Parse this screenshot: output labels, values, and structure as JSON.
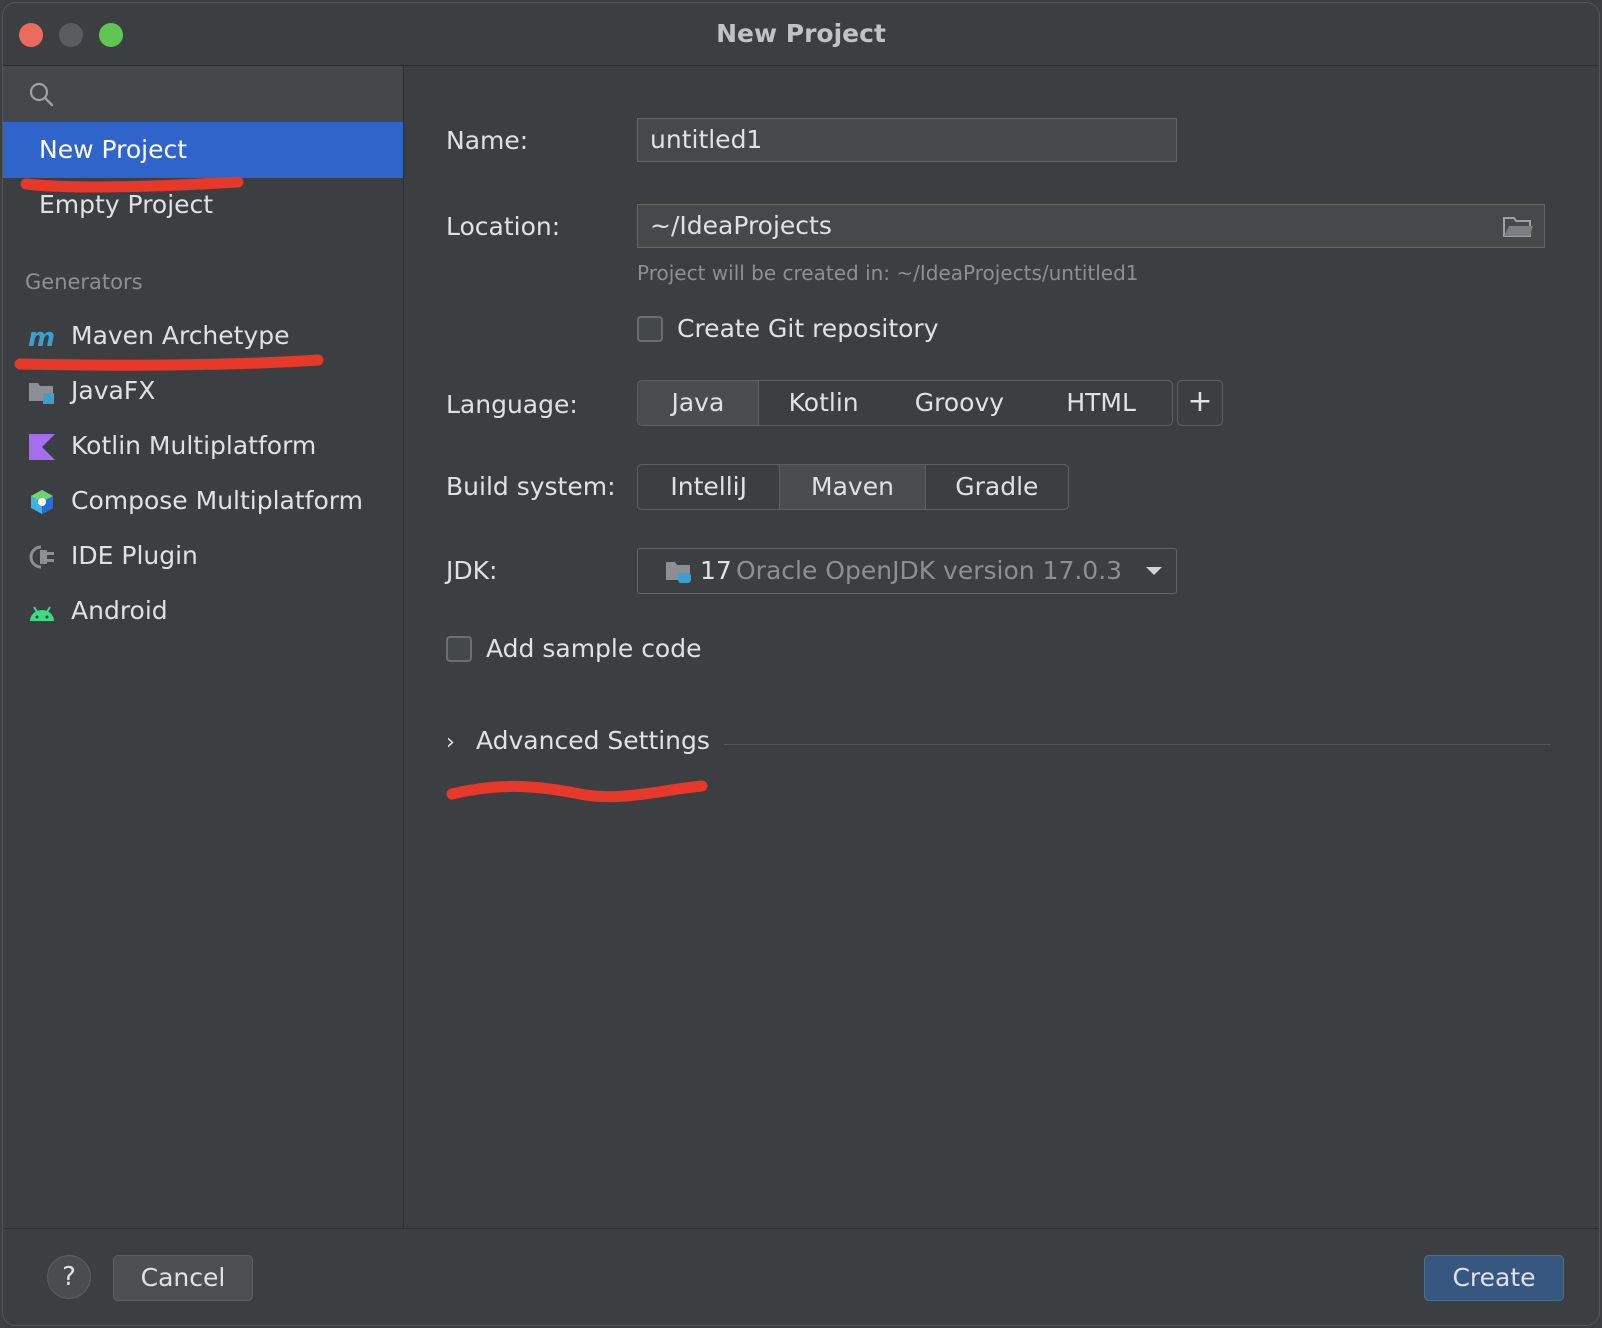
{
  "window": {
    "title": "New Project"
  },
  "sidebar": {
    "search_icon": "search-icon",
    "project_types": [
      {
        "label": "New Project",
        "selected": true
      },
      {
        "label": "Empty Project",
        "selected": false
      }
    ],
    "generators_header": "Generators",
    "generators": [
      {
        "label": "Maven Archetype",
        "icon": "maven-icon"
      },
      {
        "label": "JavaFX",
        "icon": "javafx-icon"
      },
      {
        "label": "Kotlin Multiplatform",
        "icon": "kotlin-icon"
      },
      {
        "label": "Compose Multiplatform",
        "icon": "compose-icon"
      },
      {
        "label": "IDE Plugin",
        "icon": "plugin-icon"
      },
      {
        "label": "Android",
        "icon": "android-icon"
      }
    ]
  },
  "form": {
    "name_label": "Name:",
    "name_value": "untitled1",
    "location_label": "Location:",
    "location_value": "~/IdeaProjects",
    "location_hint": "Project will be created in: ~/IdeaProjects/untitled1",
    "git_label": "Create Git repository",
    "git_checked": false,
    "language_label": "Language:",
    "languages": [
      "Java",
      "Kotlin",
      "Groovy",
      "HTML"
    ],
    "language_selected": "Java",
    "build_label": "Build system:",
    "build_systems": [
      "IntelliJ",
      "Maven",
      "Gradle"
    ],
    "build_selected": "Maven",
    "jdk_label": "JDK:",
    "jdk_version": "17",
    "jdk_description": "Oracle OpenJDK version 17.0.3",
    "sample_label": "Add sample code",
    "sample_checked": false,
    "advanced_label": "Advanced Settings"
  },
  "footer": {
    "help_label": "?",
    "cancel_label": "Cancel",
    "create_label": "Create"
  },
  "colors": {
    "selection": "#2f65ca",
    "annotation": "#e8382a",
    "primary_button": "#365880"
  }
}
